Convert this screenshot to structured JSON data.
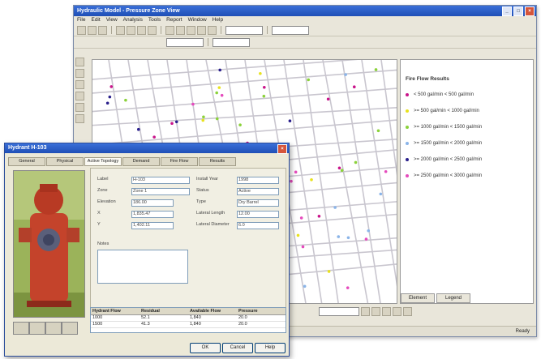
{
  "main_window": {
    "title": "Hydraulic Model - Pressure Zone View",
    "menu": [
      "File",
      "Edit",
      "View",
      "Analysis",
      "Tools",
      "Report",
      "Window",
      "Help"
    ]
  },
  "map": {
    "title": "Fire Flow Results",
    "legend_title": "Fire Flow Results",
    "legend": [
      {
        "label": "< 500 gal/min  < 500 gal/min",
        "color": "#c9148a"
      },
      {
        "label": ">= 500 gal/min  < 1000 gal/min",
        "color": "#e8e21d"
      },
      {
        "label": ">= 1000 gal/min  < 1500 gal/min",
        "color": "#8bd23a"
      },
      {
        "label": ">= 1500 gal/min  < 2000 gal/min",
        "color": "#8ab4e8"
      },
      {
        "label": ">= 2000 gal/min  < 2500 gal/min",
        "color": "#2a1f8c"
      },
      {
        "label": ">= 2500 gal/min  < 3000 gal/min",
        "color": "#e54bbd"
      }
    ],
    "legend_tabs": [
      "Element",
      "Legend"
    ]
  },
  "status": {
    "text": "Ready"
  },
  "dialog": {
    "title": "Hydrant H-103",
    "tabs": [
      "General",
      "Physical",
      "Active Topology",
      "Demand",
      "Fire Flow",
      "Results"
    ],
    "fields": {
      "label_label": "Label",
      "label_value": "H-103",
      "zone_label": "Zone",
      "zone_value": "Zone 1",
      "elevation_label": "Elevation",
      "elevation_value": "186.00",
      "x_label": "X",
      "x_value": "1,835.47",
      "y_label": "Y",
      "y_value": "1,402.11",
      "notes_label": "Notes",
      "install_label": "Install Year",
      "install_value": "1998",
      "status_label": "Status",
      "status_value": "Active",
      "type_label": "Type",
      "type_value": "Dry Barrel",
      "lateral_label": "Lateral Length",
      "lateral_value": "12.00",
      "dia_label": "Lateral Diameter",
      "dia_value": "6.0"
    },
    "grid": {
      "headers": [
        "Hydrant Flow",
        "Residual",
        "Available Flow",
        "Pressure"
      ],
      "rows": [
        [
          "1000",
          "52.1",
          "1,840",
          "20.0"
        ],
        [
          "1500",
          "41.3",
          "1,840",
          "20.0"
        ]
      ]
    },
    "buttons": {
      "ok": "OK",
      "cancel": "Cancel",
      "help": "Help"
    }
  }
}
